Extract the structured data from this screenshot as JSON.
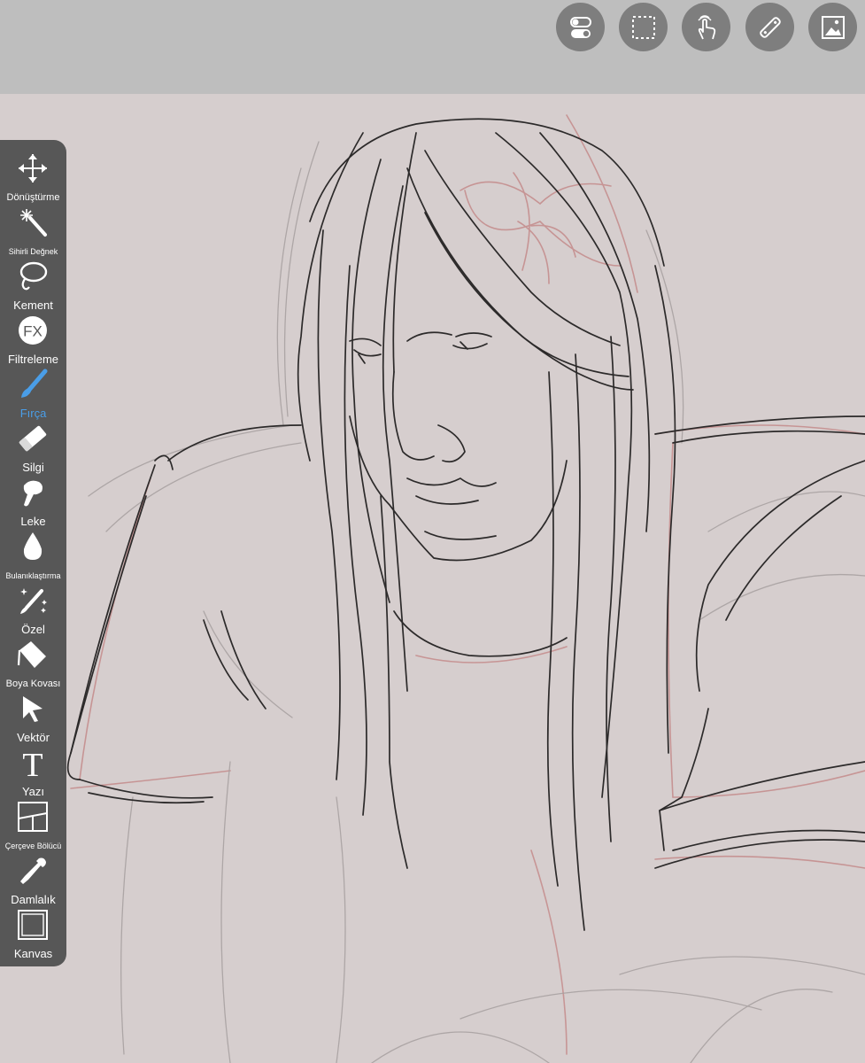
{
  "app": {
    "accent": "#4a9ee8",
    "toolbar_bg": "#575757",
    "topbar_bg": "#bebebe",
    "canvas_bg": "#d6cece"
  },
  "top_toolbar": [
    {
      "icon": "toggle-switch-icon"
    },
    {
      "icon": "selection-marquee-icon"
    },
    {
      "icon": "touch-gesture-icon"
    },
    {
      "icon": "ruler-icon"
    },
    {
      "icon": "layers-gallery-icon"
    }
  ],
  "tools": [
    {
      "label": "Dönüştürme",
      "icon": "move-arrows-icon"
    },
    {
      "label": "Sihirli Değnek",
      "icon": "magic-wand-icon"
    },
    {
      "label": "Kement",
      "icon": "lasso-icon"
    },
    {
      "label": "Filtreleme",
      "icon": "fx-filter-icon",
      "fx_text": "FX"
    },
    {
      "label": "Fırça",
      "icon": "brush-icon",
      "active": true
    },
    {
      "label": "Silgi",
      "icon": "eraser-icon"
    },
    {
      "label": "Leke",
      "icon": "smudge-finger-icon"
    },
    {
      "label": "Bulanıklaştırma",
      "icon": "blur-drop-icon"
    },
    {
      "label": "Özel",
      "icon": "special-brush-icon"
    },
    {
      "label": "Boya Kovası",
      "icon": "paint-bucket-icon"
    },
    {
      "label": "Vektör",
      "icon": "vector-cursor-icon"
    },
    {
      "label": "Yazı",
      "icon": "text-icon",
      "glyph": "T"
    },
    {
      "label": "Çerçeve Bölücü",
      "icon": "frame-divider-icon"
    },
    {
      "label": "Damlalık",
      "icon": "eyedropper-icon"
    },
    {
      "label": "Kanvas",
      "icon": "canvas-icon"
    }
  ]
}
